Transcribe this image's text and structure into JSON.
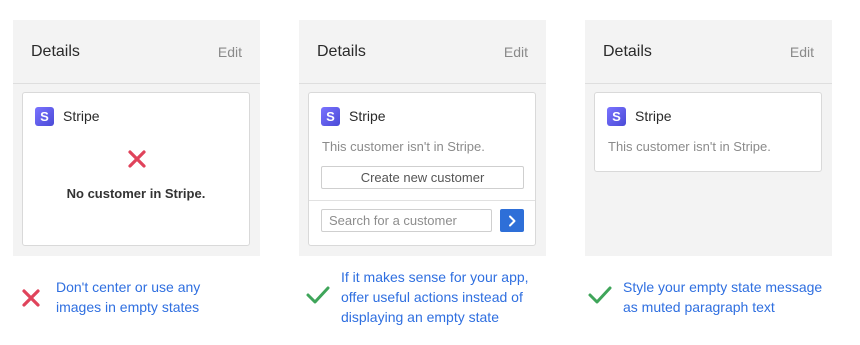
{
  "panels": [
    {
      "title": "Details",
      "edit_label": "Edit",
      "brand": "Stripe",
      "empty_message": "No customer in Stripe."
    },
    {
      "title": "Details",
      "edit_label": "Edit",
      "brand": "Stripe",
      "message": "This customer isn't in Stripe.",
      "create_button": "Create new customer",
      "search_placeholder": "Search for a customer"
    },
    {
      "title": "Details",
      "edit_label": "Edit",
      "brand": "Stripe",
      "message": "This customer isn't in Stripe."
    }
  ],
  "captions": [
    {
      "status": "dont",
      "lines": [
        "Don't center or use any",
        "images in empty states"
      ]
    },
    {
      "status": "do",
      "lines": [
        "If it makes sense for your app,",
        "offer useful actions instead of",
        "displaying an empty state"
      ]
    },
    {
      "status": "do",
      "lines": [
        "Style your empty state message",
        "as muted paragraph text"
      ]
    }
  ],
  "colors": {
    "dont": "#e0435b",
    "do": "#3fa55a",
    "caption_text": "#2f6fe0",
    "brand_logo": "#5b54e8",
    "primary_button": "#2e6fd8"
  },
  "icons": {
    "brand": "stripe-logo-icon",
    "dont": "x-icon",
    "do": "checkmark-icon",
    "go": "chevron-right-icon"
  }
}
